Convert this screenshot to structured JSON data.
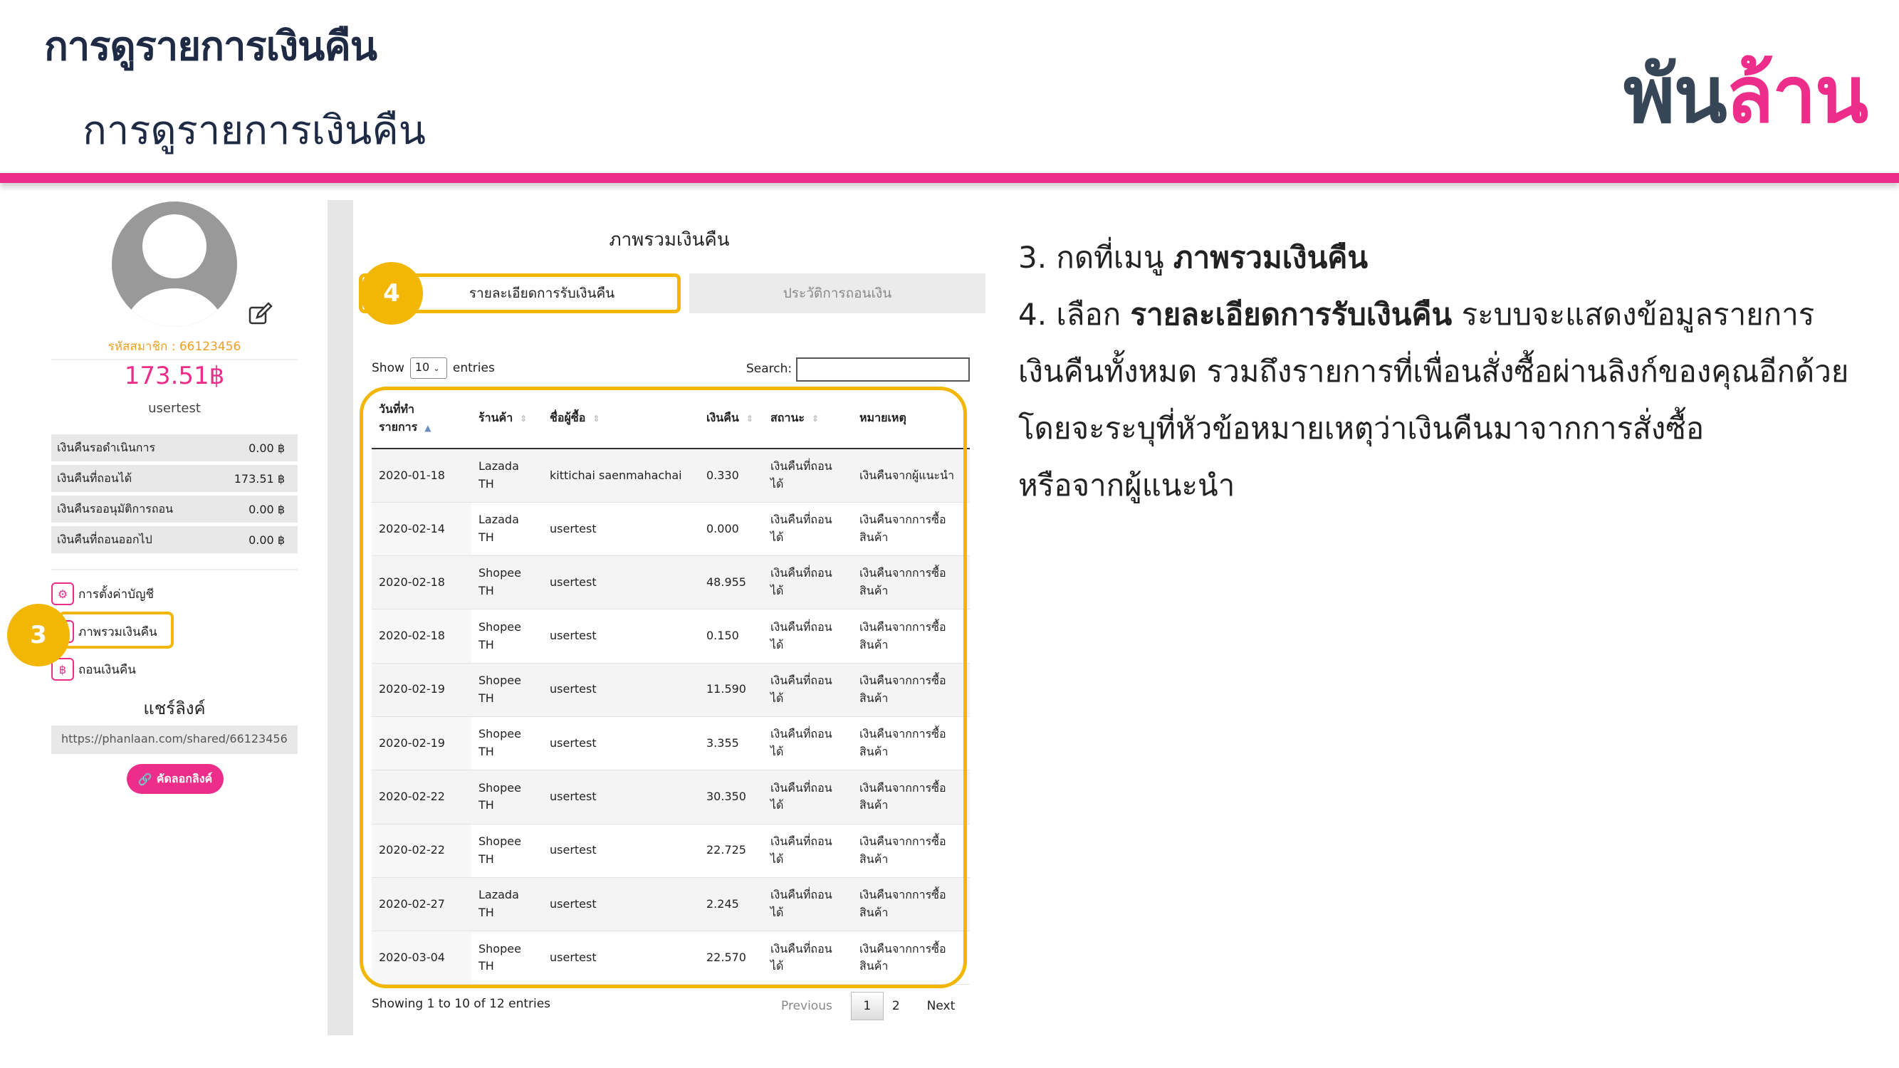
{
  "header": {
    "title": "การดูรายการเงินคืน",
    "subtitle": "การดูรายการเงินคืน",
    "logo_part1": "พัน",
    "logo_part2": "ล้าน"
  },
  "colors": {
    "brand_pink": "#ec2e8a",
    "highlight_yellow": "#f2b705",
    "navy": "#1f2a44"
  },
  "profile": {
    "member_id": "รหัสสมาชิก : 66123456",
    "balance": "173.51฿",
    "username": "usertest",
    "stats": [
      {
        "label": "เงินคืนรอดำเนินการ",
        "value": "0.00 ฿"
      },
      {
        "label": "เงินคืนที่ถอนได้",
        "value": "173.51 ฿"
      },
      {
        "label": "เงินคืนรออนุมัติการถอน",
        "value": "0.00 ฿"
      },
      {
        "label": "เงินคืนที่ถอนออกไป",
        "value": "0.00 ฿"
      }
    ],
    "menu": [
      {
        "label": "การตั้งค่าบัญชี",
        "icon": "settings-icon"
      },
      {
        "label": "ภาพรวมเงินคืน",
        "icon": "overview-icon"
      },
      {
        "label": "ถอนเงินคืน",
        "icon": "withdraw-icon"
      }
    ],
    "share_title": "แชร์ลิงค์",
    "share_link": "https://phanlaan.com/shared/66123456",
    "copy_button": "คัดลอกลิงค์"
  },
  "steps": {
    "step3": "3",
    "step4": "4"
  },
  "panel": {
    "title": "ภาพรวมเงินคืน",
    "tabs": [
      {
        "label": "รายละเอียดการรับเงินคืน"
      },
      {
        "label": "ประวัติการถอนเงิน"
      }
    ],
    "show_label": "Show",
    "entries_value": "10",
    "entries_label": "entries",
    "search_label": "Search:",
    "columns": [
      "วันที่ทำรายการ",
      "ร้านค้า",
      "ชื่อผู้ซื้อ",
      "เงินคืน",
      "สถานะ",
      "หมายเหตุ"
    ],
    "rows": [
      {
        "date": "2020-01-18",
        "shop": "Lazada TH",
        "buyer": "kittichai saenmahachai",
        "amount": "0.330",
        "status": "เงินคืนที่ถอนได้",
        "note": "เงินคืนจากผู้แนะนำ"
      },
      {
        "date": "2020-02-14",
        "shop": "Lazada TH",
        "buyer": "usertest",
        "amount": "0.000",
        "status": "เงินคืนที่ถอนได้",
        "note": "เงินคืนจากการซื้อสินค้า"
      },
      {
        "date": "2020-02-18",
        "shop": "Shopee TH",
        "buyer": "usertest",
        "amount": "48.955",
        "status": "เงินคืนที่ถอนได้",
        "note": "เงินคืนจากการซื้อสินค้า"
      },
      {
        "date": "2020-02-18",
        "shop": "Shopee TH",
        "buyer": "usertest",
        "amount": "0.150",
        "status": "เงินคืนที่ถอนได้",
        "note": "เงินคืนจากการซื้อสินค้า"
      },
      {
        "date": "2020-02-19",
        "shop": "Shopee TH",
        "buyer": "usertest",
        "amount": "11.590",
        "status": "เงินคืนที่ถอนได้",
        "note": "เงินคืนจากการซื้อสินค้า"
      },
      {
        "date": "2020-02-19",
        "shop": "Shopee TH",
        "buyer": "usertest",
        "amount": "3.355",
        "status": "เงินคืนที่ถอนได้",
        "note": "เงินคืนจากการซื้อสินค้า"
      },
      {
        "date": "2020-02-22",
        "shop": "Shopee TH",
        "buyer": "usertest",
        "amount": "30.350",
        "status": "เงินคืนที่ถอนได้",
        "note": "เงินคืนจากการซื้อสินค้า"
      },
      {
        "date": "2020-02-22",
        "shop": "Shopee TH",
        "buyer": "usertest",
        "amount": "22.725",
        "status": "เงินคืนที่ถอนได้",
        "note": "เงินคืนจากการซื้อสินค้า"
      },
      {
        "date": "2020-02-27",
        "shop": "Lazada TH",
        "buyer": "usertest",
        "amount": "2.245",
        "status": "เงินคืนที่ถอนได้",
        "note": "เงินคืนจากการซื้อสินค้า"
      },
      {
        "date": "2020-03-04",
        "shop": "Shopee TH",
        "buyer": "usertest",
        "amount": "22.570",
        "status": "เงินคืนที่ถอนได้",
        "note": "เงินคืนจากการซื้อสินค้า"
      }
    ],
    "info": "Showing 1 to 10 of 12 entries",
    "pagination": {
      "previous": "Previous",
      "pages": [
        "1",
        "2"
      ],
      "next": "Next"
    }
  },
  "instructions": {
    "line1_prefix": "3. กดที่เมนู ",
    "line1_bold": "ภาพรวมเงินคืน",
    "line2_prefix": "4. เลือก ",
    "line2_bold": "รายละเอียดการรับเงินคืน",
    "line2_suffix": " ระบบจะแสดงข้อมูลรายการ",
    "line3": "เงินคืนทั้งหมด รวมถึงรายการที่เพื่อนสั่งซื้อผ่านลิงก์ของคุณอีกด้วย",
    "line4": "โดยจะระบุที่หัวข้อหมายเหตุว่าเงินคืนมาจากการสั่งซื้อ",
    "line5": "หรือจากผู้แนะนำ"
  }
}
